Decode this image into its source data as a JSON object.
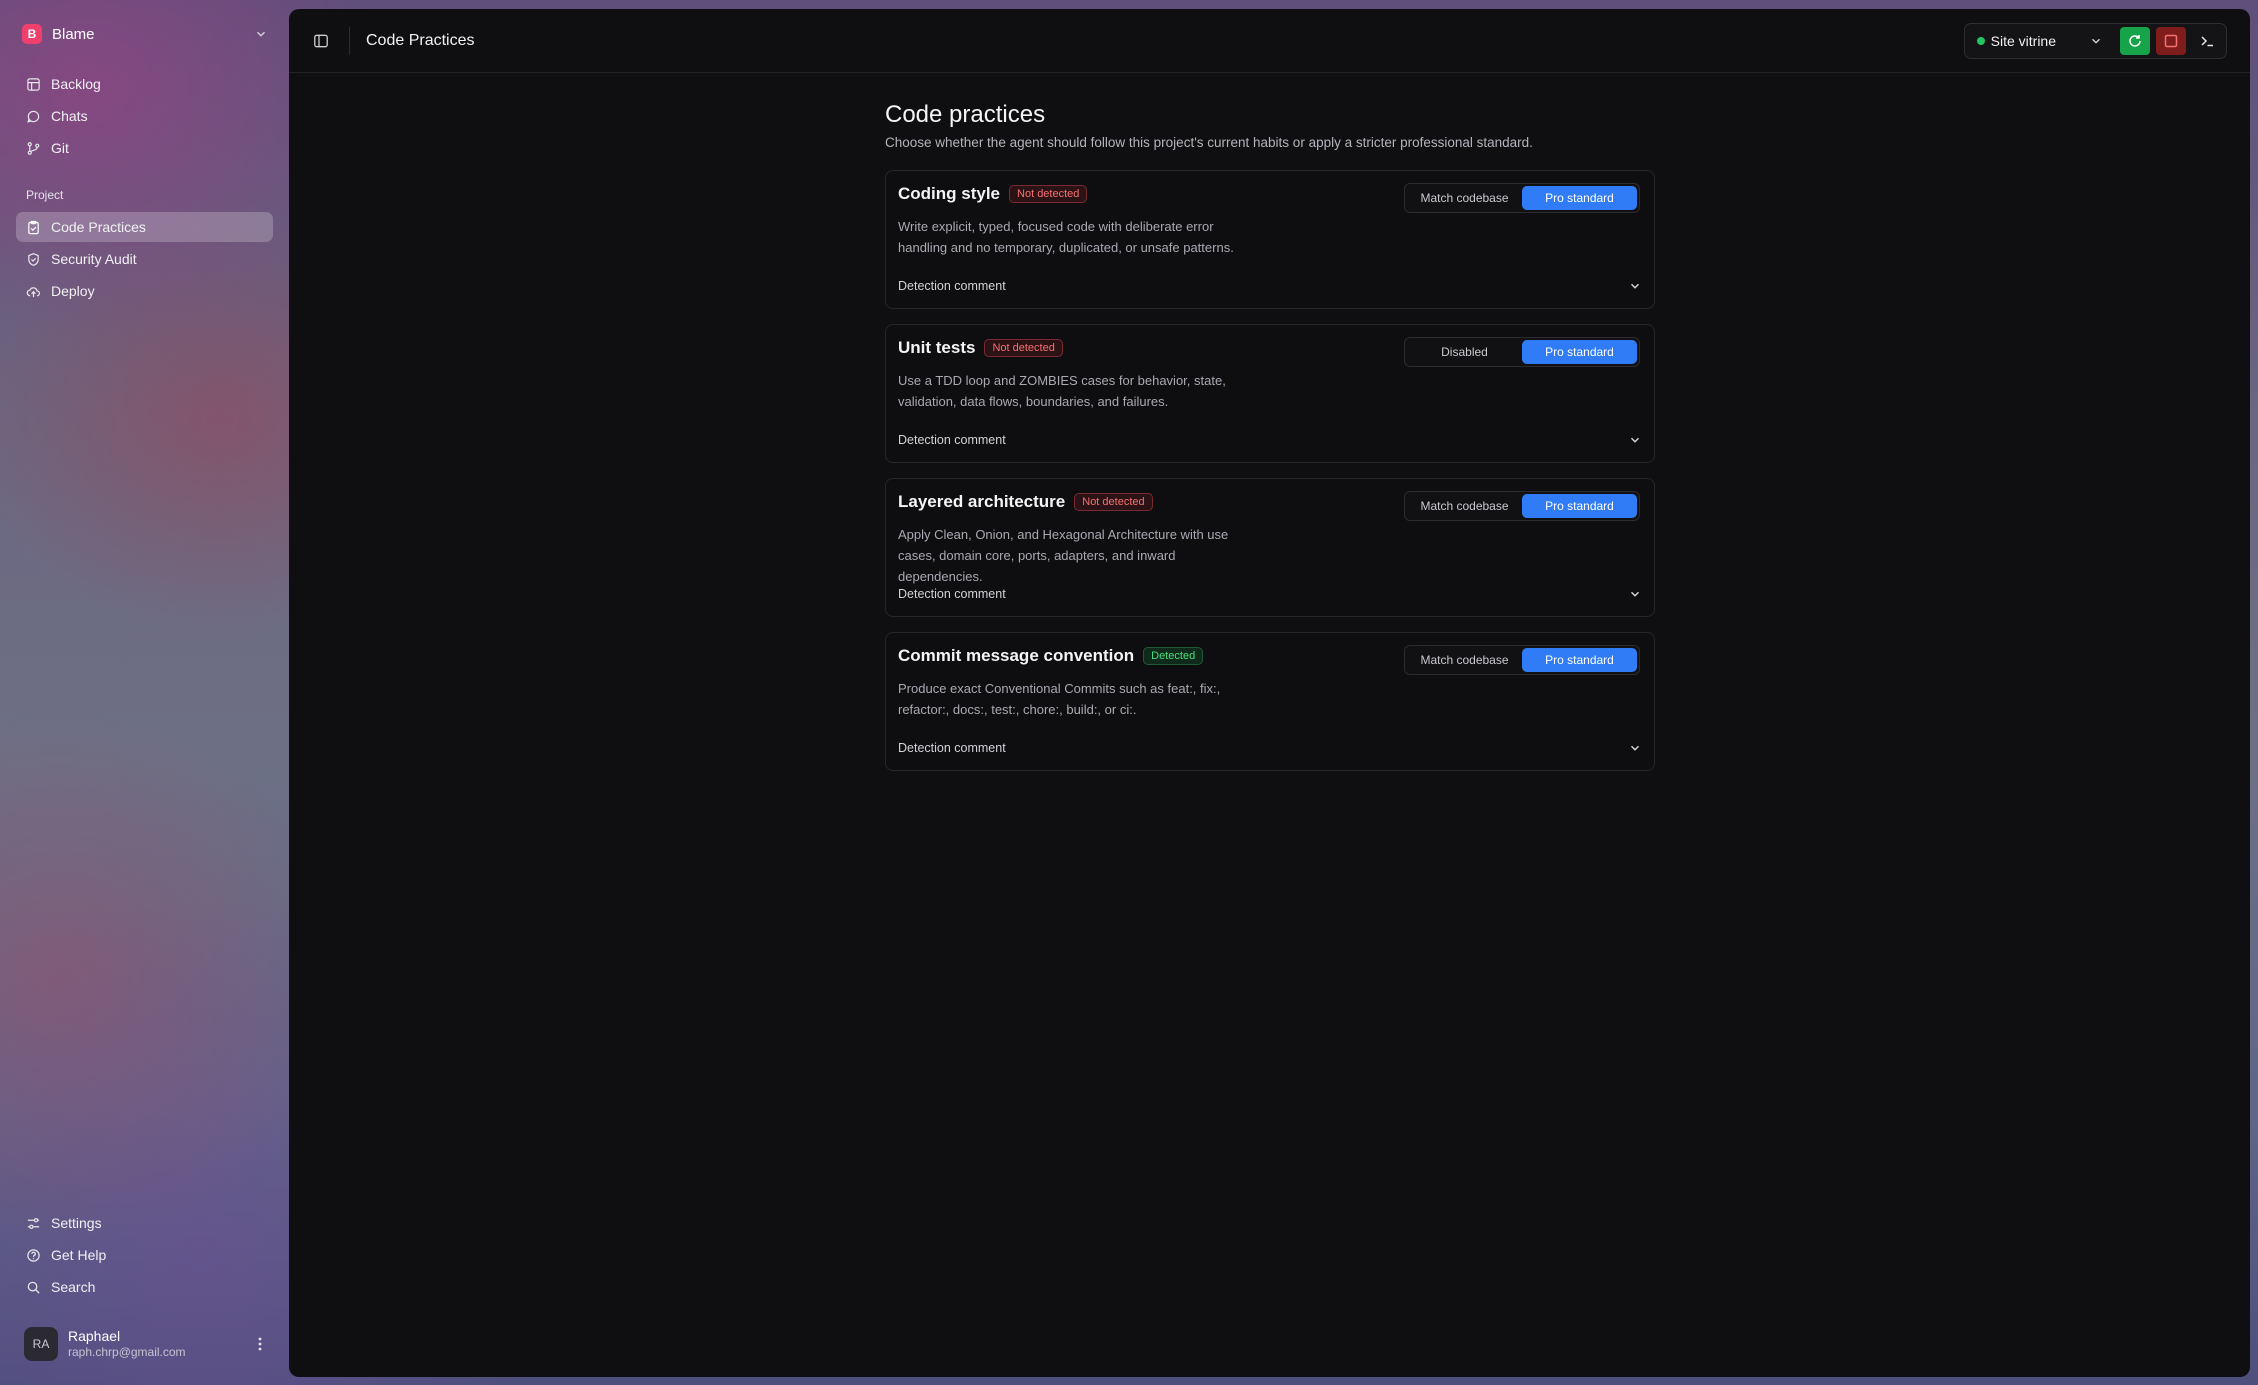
{
  "workspace": {
    "initial": "B",
    "name": "Blame"
  },
  "nav_top": [
    {
      "label": "Backlog"
    },
    {
      "label": "Chats"
    },
    {
      "label": "Git"
    }
  ],
  "project_section": {
    "label": "Project",
    "items": [
      {
        "label": "Code Practices",
        "active": true
      },
      {
        "label": "Security Audit"
      },
      {
        "label": "Deploy"
      }
    ]
  },
  "nav_bottom": [
    {
      "label": "Settings"
    },
    {
      "label": "Get Help"
    },
    {
      "label": "Search"
    }
  ],
  "user": {
    "initials": "RA",
    "name": "Raphael",
    "email": "raph.chrp@gmail.com"
  },
  "topbar": {
    "title": "Code Practices"
  },
  "site": {
    "name": "Site vitrine",
    "status_color": "#22c55e"
  },
  "page": {
    "title": "Code practices",
    "subtitle": "Choose whether the agent should follow this project's current habits or apply a stricter professional standard."
  },
  "practices": [
    {
      "title": "Coding style",
      "status": "Not detected",
      "status_kind": "bad",
      "description": "Write explicit, typed, focused code with deliberate error handling and no temporary, duplicated, or unsafe patterns.",
      "option_a": "Match codebase",
      "option_b": "Pro standard",
      "selected": "option_b",
      "detection_label": "Detection comment"
    },
    {
      "title": "Unit tests",
      "status": "Not detected",
      "status_kind": "bad",
      "description": "Use a TDD loop and ZOMBIES cases for behavior, state, validation, data flows, boundaries, and failures.",
      "option_a": "Disabled",
      "option_b": "Pro standard",
      "selected": "option_b",
      "detection_label": "Detection comment"
    },
    {
      "title": "Layered architecture",
      "status": "Not detected",
      "status_kind": "bad",
      "description": "Apply Clean, Onion, and Hexagonal Architecture with use cases, domain core, ports, adapters, and inward dependencies.",
      "option_a": "Match codebase",
      "option_b": "Pro standard",
      "selected": "option_b",
      "detection_label": "Detection comment"
    },
    {
      "title": "Commit message convention",
      "status": "Detected",
      "status_kind": "good",
      "description": "Produce exact Conventional Commits such as feat:, fix:, refactor:, docs:, test:, chore:, build:, or ci:.",
      "option_a": "Match codebase",
      "option_b": "Pro standard",
      "selected": "option_b",
      "detection_label": "Detection comment"
    }
  ],
  "colors": {
    "accent": "#2f7cf6",
    "workspace_badge": "#ef3f6c",
    "refresh_button": "#16a34a",
    "stop_button": "#7f1d1d"
  }
}
